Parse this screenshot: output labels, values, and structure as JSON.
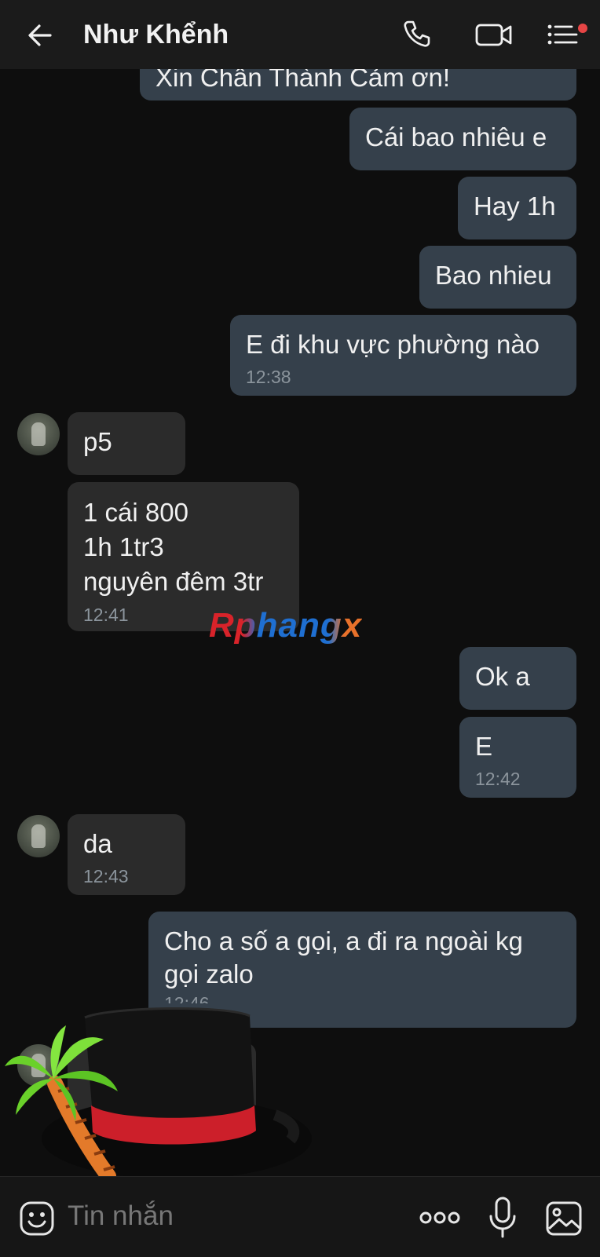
{
  "header": {
    "back_icon": "arrow-left-icon",
    "contact_name": "Như Khểnh",
    "call_icon": "phone-icon",
    "video_icon": "video-camera-icon",
    "menu_icon": "list-menu-icon",
    "notification_dot_color": "#e64545"
  },
  "messages": [
    {
      "side": "out",
      "text": "Xin Chân Thành Cảm ơn!"
    },
    {
      "side": "out",
      "text": "Cái bao nhiêu e"
    },
    {
      "side": "out",
      "text": "Hay 1h"
    },
    {
      "side": "out",
      "text": "Bao nhieu"
    },
    {
      "side": "out",
      "text": "E đi khu vực phường nào",
      "time": "12:38"
    },
    {
      "side": "in",
      "text": "p5"
    },
    {
      "side": "in",
      "text": "1 cái 800\n1h 1tr3\nnguyên đêm 3tr",
      "time": "12:41"
    },
    {
      "side": "out",
      "text": "Ok a"
    },
    {
      "side": "out",
      "text": "E",
      "time": "12:42"
    },
    {
      "side": "in",
      "text": "da",
      "time": "12:43"
    },
    {
      "side": "out",
      "text": "Cho a số a gọi, a đi ra ngoài kg\ngọi zalo",
      "time": "12:46"
    },
    {
      "side": "in",
      "text": ""
    }
  ],
  "watermark": "Rphangx",
  "sticker": "top-hat-palm-tree-sticker",
  "input": {
    "emoji_icon": "emoji-icon",
    "placeholder": "Tin nhắn",
    "more_icon": "more-dots-icon",
    "mic_icon": "microphone-icon",
    "image_icon": "image-icon"
  },
  "colors": {
    "background": "#0e0e0e",
    "header": "#1b1b1b",
    "outgoing_bubble": "#35404b",
    "incoming_bubble": "#2b2b2b",
    "timestamp": "#8b949c"
  }
}
